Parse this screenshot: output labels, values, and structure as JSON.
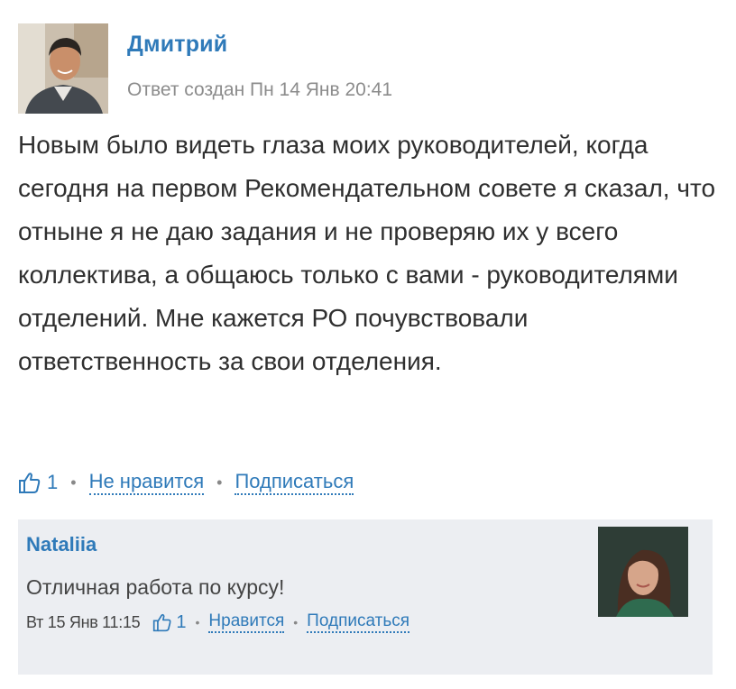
{
  "post": {
    "author": "Дмитрий",
    "meta": "Ответ создан Пн 14 Янв 20:41",
    "body": "Новым было видеть глаза моих руководителей, когда сегодня на первом Рекомендательном совете я сказал, что отныне я не даю задания и не проверяю их у всего коллектива, а общаюсь только с вами - руководителями отделений. Мне кажется РО почувствовали ответственность за свои отделения.",
    "likes": "1",
    "dislike_label": "Не нравится",
    "subscribe_label": "Подписаться",
    "icons": {
      "avatar": "man-portrait",
      "like": "thumbs-up-icon"
    }
  },
  "comment": {
    "author": "Nataliia",
    "text": "Отличная работа по курсу!",
    "date": "Вт 15 Янв 11:15",
    "likes": "1",
    "like_label": "Нравится",
    "subscribe_label": "Подписаться",
    "icons": {
      "avatar": "woman-portrait",
      "like": "thumbs-up-icon"
    }
  },
  "colors": {
    "accent": "#2f7ab9",
    "comment_bg": "#eceef2",
    "meta_text": "#8c8c8c"
  }
}
